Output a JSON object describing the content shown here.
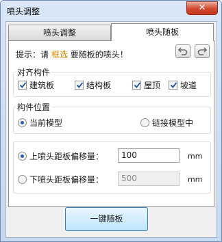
{
  "window": {
    "title": "喷头调整",
    "close_label": "✕"
  },
  "tabs": [
    {
      "label": "喷头调整"
    },
    {
      "label": "喷头随板"
    }
  ],
  "hint": {
    "prefix": "提示：请",
    "link": "框选",
    "suffix": "要随板的喷头！"
  },
  "nav": {
    "undo_icon": "undo-icon",
    "redo_icon": "redo-icon"
  },
  "align_group": {
    "title": "对齐构件",
    "items": [
      {
        "label": "建筑板",
        "checked": true
      },
      {
        "label": "结构板",
        "checked": true
      },
      {
        "label": "屋顶",
        "checked": true
      },
      {
        "label": "坡道",
        "checked": true
      }
    ]
  },
  "position_group": {
    "title": "构件位置",
    "options": [
      {
        "label": "当前模型",
        "selected": true
      },
      {
        "label": "链接模型中",
        "selected": false
      }
    ]
  },
  "offset_group": {
    "upper": {
      "label": "上喷头距板偏移量：",
      "value": "100",
      "unit": "mm",
      "selected": true
    },
    "lower": {
      "label": "下喷头距板偏移量：",
      "value": "500",
      "unit": "mm",
      "selected": false
    }
  },
  "action_button": {
    "label": "一键随板"
  },
  "colors": {
    "accent": "#2d5fa8",
    "hint_link": "#e08a00"
  }
}
